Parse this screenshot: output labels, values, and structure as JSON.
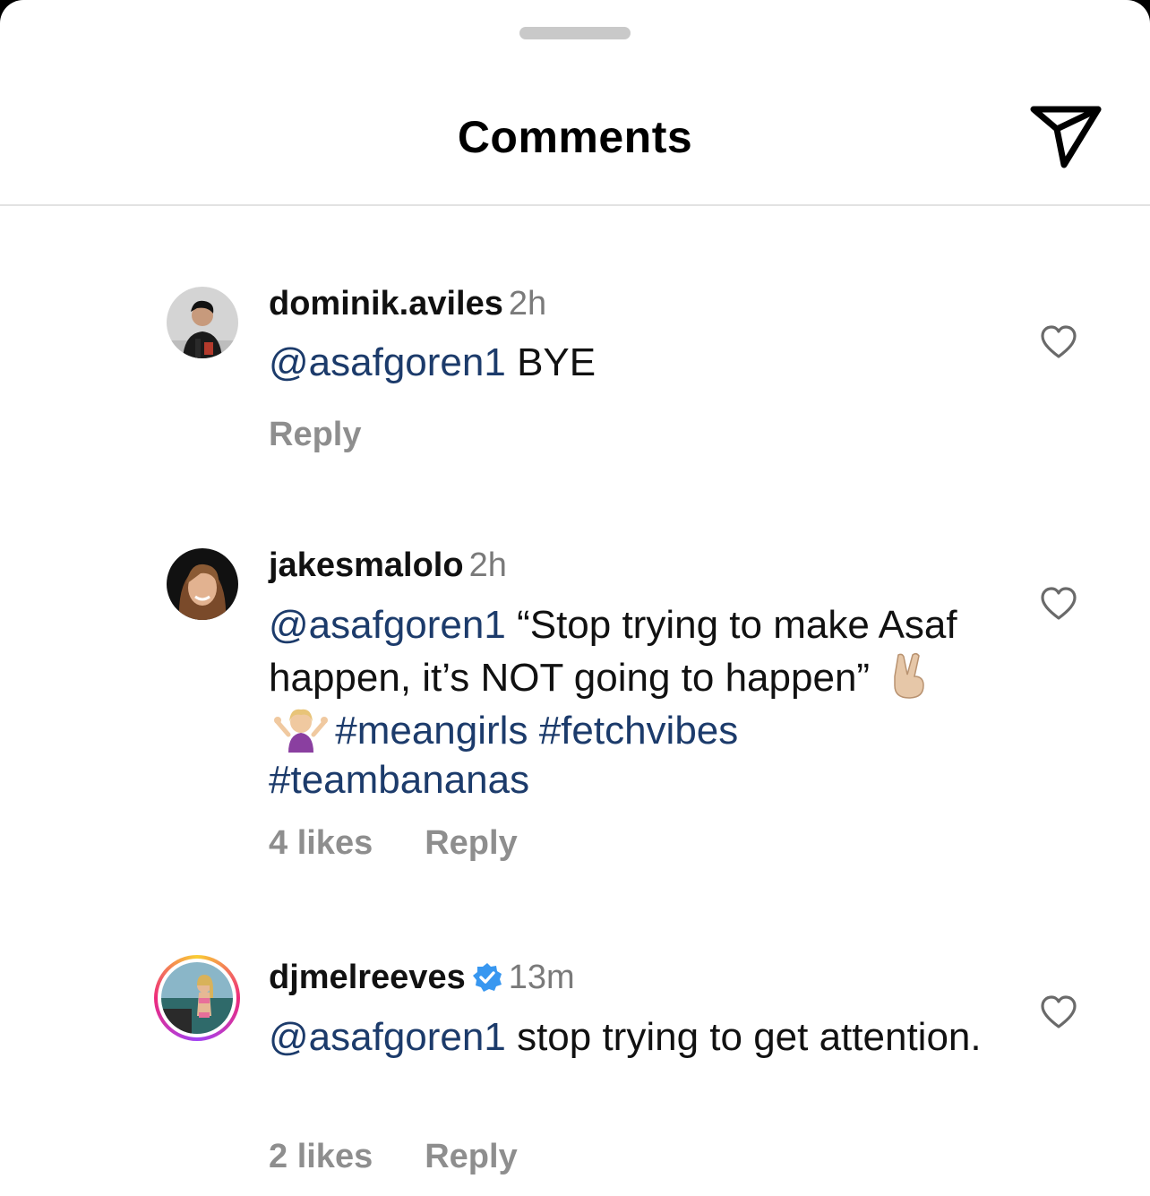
{
  "sheet": {
    "title": "Comments"
  },
  "comments": [
    {
      "username": "dominik.aviles",
      "time": "2h",
      "mention": "@asafgoren1",
      "text": " BYE",
      "likes": "",
      "reply_label": "Reply"
    },
    {
      "username": "jakesmalolo",
      "time": "2h",
      "mention": "@asafgoren1",
      "text": " “Stop trying to make Asaf happen, it’s NOT going to happen”",
      "emojis": [
        "victory-hand-emoji",
        "shrugging-woman-emoji"
      ],
      "hashtags": [
        "#meangirls",
        "#fetchvibes",
        "#teambananas"
      ],
      "likes": "4 likes",
      "reply_label": "Reply"
    },
    {
      "username": "djmelreeves",
      "verified": true,
      "time": "13m",
      "mention": "@asafgoren1",
      "text": " stop trying to get attention.",
      "likes": "2 likes",
      "reply_label": "Reply"
    }
  ],
  "colors": {
    "link": "#1c3b6b",
    "muted": "#8e8e8e",
    "verified": "#3897f0"
  }
}
